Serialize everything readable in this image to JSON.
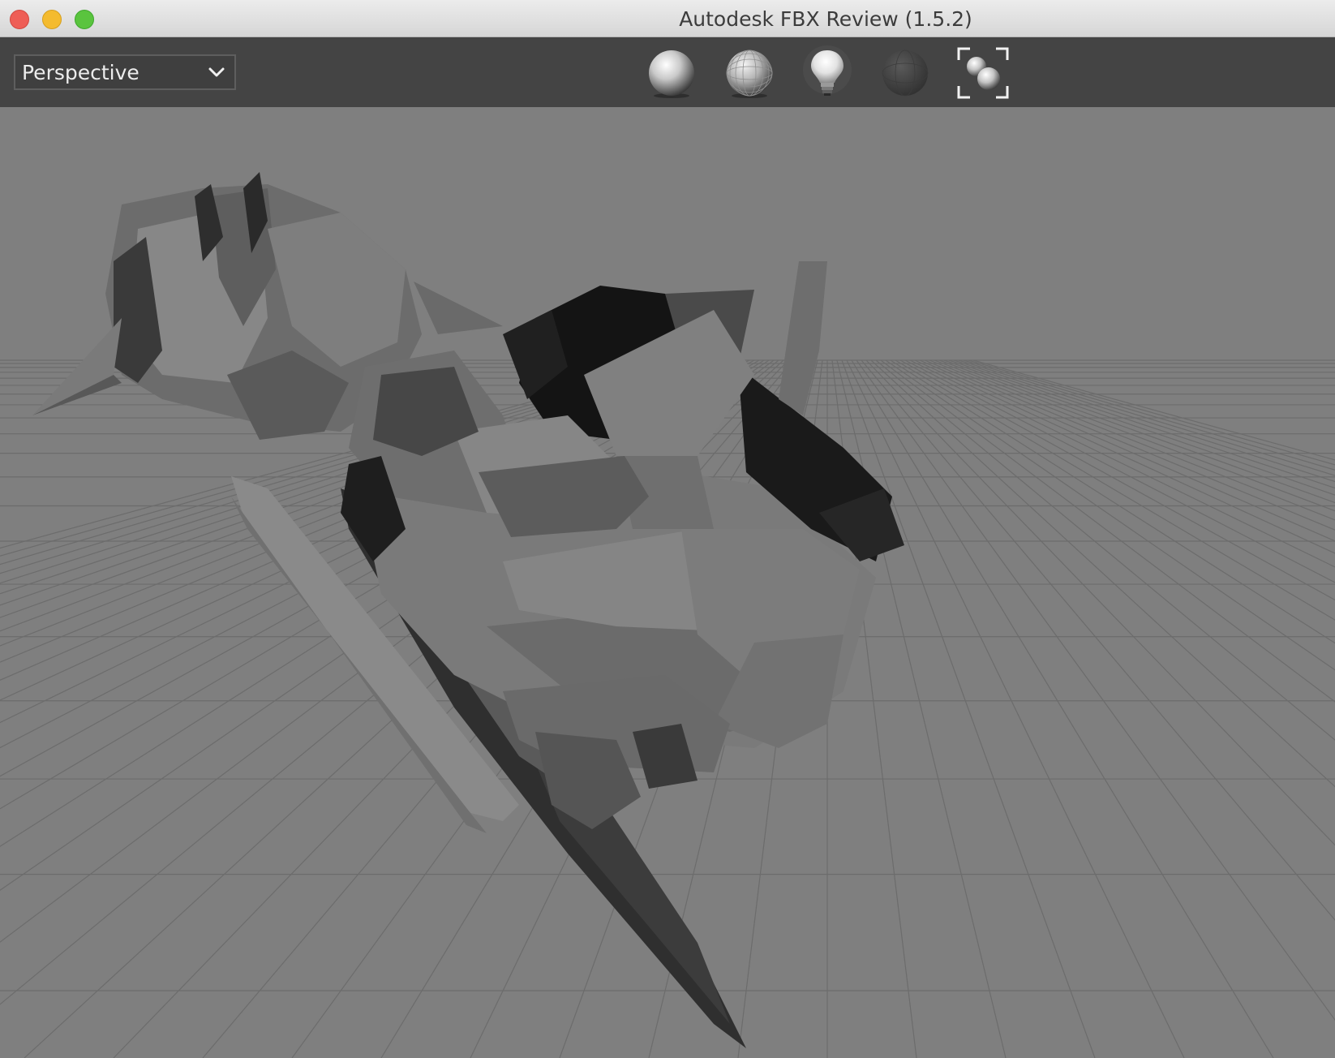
{
  "window": {
    "title": "Autodesk FBX Review (1.5.2)"
  },
  "toolbar": {
    "camera_select": {
      "value": "Perspective"
    },
    "buttons": [
      {
        "name": "shaded-sphere-icon",
        "tooltip": ""
      },
      {
        "name": "wireframe-sphere-icon",
        "tooltip": ""
      },
      {
        "name": "lightbulb-icon",
        "tooltip": ""
      },
      {
        "name": "dark-sphere-icon",
        "tooltip": ""
      },
      {
        "name": "frame-all-icon",
        "tooltip": ""
      }
    ]
  },
  "colors": {
    "titlebar": "#e2e2e2",
    "toolbar": "#444444",
    "viewport": "#7f7f7f",
    "grid": "#6c6c6c",
    "mesh_light": "#8a8a8a",
    "mesh_mid": "#6a6a6a",
    "mesh_dark": "#2e2e2e"
  }
}
